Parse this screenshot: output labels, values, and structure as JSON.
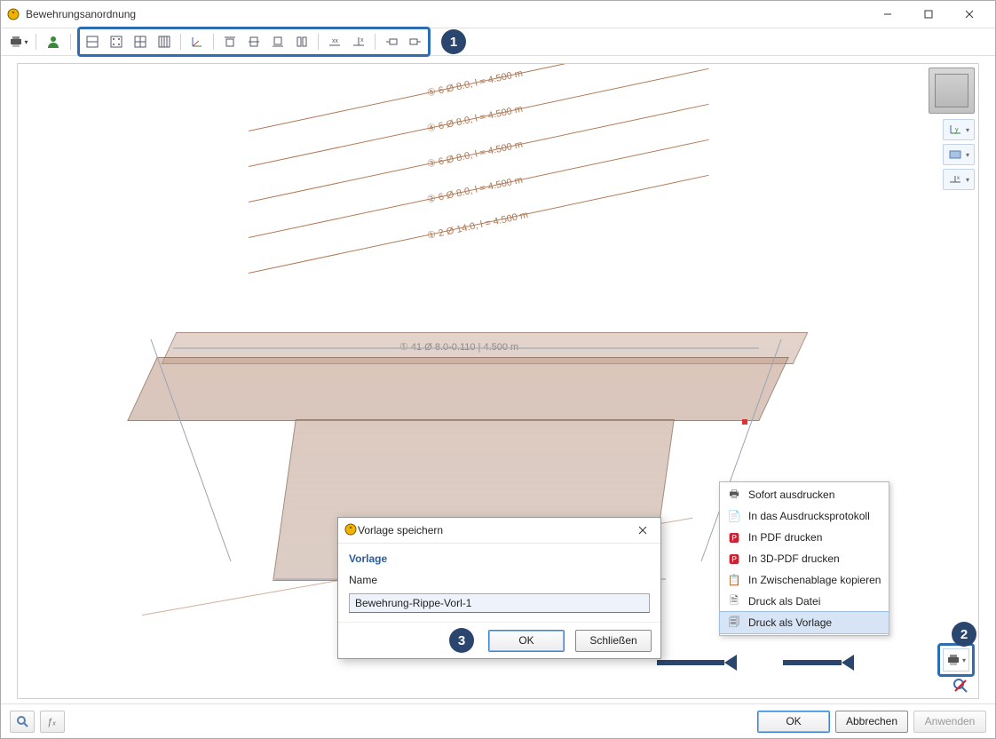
{
  "window": {
    "title": "Bewehrungsanordnung"
  },
  "rebars": [
    {
      "label": "⑤ 6 Ø 8.0, l = 4.500 m"
    },
    {
      "label": "④ 6 Ø 8.0, l = 4.500 m"
    },
    {
      "label": "③ 6 Ø 8.0, l = 4.500 m"
    },
    {
      "label": "② 6 Ø 8.0, l = 4.500 m"
    },
    {
      "label": "① 2 Ø 14.0, l = 4.500 m"
    }
  ],
  "beam_dim": "① 41 Ø 8.0-0.110 | 4.500 m",
  "context_menu": {
    "items": [
      "Sofort ausdrucken",
      "In das Ausdrucksprotokoll",
      "In PDF drucken",
      "In 3D-PDF drucken",
      "In Zwischenablage kopieren",
      "Druck als Datei",
      "Druck als Vorlage"
    ]
  },
  "dialog": {
    "title": "Vorlage speichern",
    "group": "Vorlage",
    "name_label": "Name",
    "name_value": "Bewehrung-Rippe-Vorl-1",
    "ok": "OK",
    "close": "Schließen"
  },
  "footer": {
    "ok": "OK",
    "cancel": "Abbrechen",
    "apply": "Anwenden"
  },
  "markers": {
    "one": "1",
    "two": "2",
    "three": "3"
  }
}
